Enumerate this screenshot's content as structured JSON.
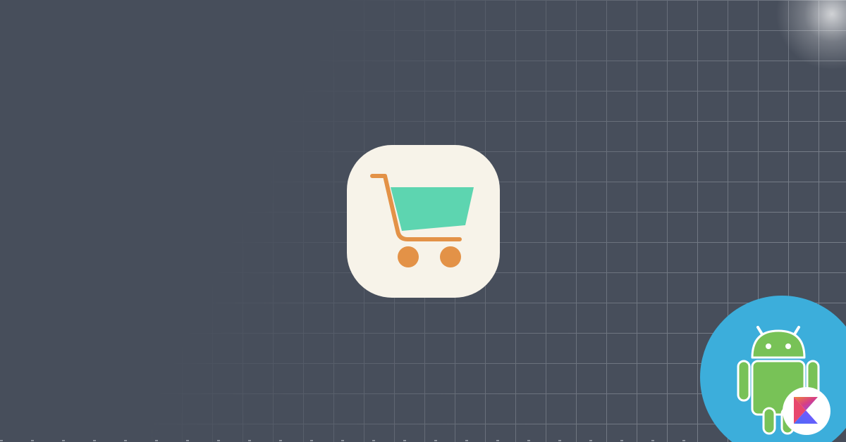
{
  "scene": {
    "background_color": "#474e5b",
    "grid_line_color": "#8a909a",
    "icons": {
      "center": "shopping-cart-icon",
      "badge": "android-robot-icon",
      "overlay": "kotlin-logo-icon"
    },
    "colors": {
      "app_icon_bg": "#f7f3e9",
      "cart_frame": "#e39247",
      "cart_basket": "#5dd5b0",
      "badge_bg": "#3caedb",
      "android_green": "#78c257",
      "android_outline": "#ffffff"
    }
  }
}
